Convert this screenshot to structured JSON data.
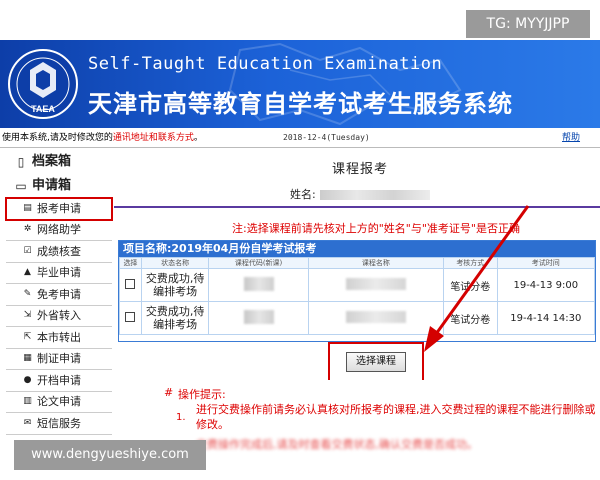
{
  "watermark_top": "TG: MYYJJPP",
  "watermark_bottom": "www.dengyueshiye.com",
  "banner": {
    "title_en": "Self-Taught Education Examination",
    "title_cn": "天津市高等教育自学考试考生服务系统",
    "logo_text": "TAEA",
    "bg_color": "#1c62d8"
  },
  "infobar": {
    "notice_prefix": "使用本系统,请及时修改您的",
    "notice_red": "通讯地址和联系方式",
    "notice_suffix": "。",
    "date": "2018-12-4(Tuesday)",
    "help": "帮助"
  },
  "sidebar": {
    "sections": [
      {
        "label": "档案箱",
        "icon": "archive-icon"
      },
      {
        "label": "申请箱",
        "icon": "folder-icon"
      }
    ],
    "items": [
      {
        "label": "报考申请",
        "icon": "document-icon",
        "active": true
      },
      {
        "label": "网络助学",
        "icon": "network-icon"
      },
      {
        "label": "成绩核查",
        "icon": "check-icon"
      },
      {
        "label": "毕业申请",
        "icon": "graduation-icon"
      },
      {
        "label": "免考申请",
        "icon": "edit-icon"
      },
      {
        "label": "外省转入",
        "icon": "transfer-in-icon"
      },
      {
        "label": "本市转出",
        "icon": "transfer-out-icon"
      },
      {
        "label": "制证申请",
        "icon": "certificate-icon"
      },
      {
        "label": "开档申请",
        "icon": "person-icon"
      },
      {
        "label": "论文申请",
        "icon": "paper-icon"
      },
      {
        "label": "短信服务",
        "icon": "sms-icon"
      }
    ]
  },
  "main": {
    "page_title": "课程报考",
    "name_label": "姓名:",
    "warning": "注:选择课程前请先核对上方的\"姓名\"与\"准考证号\"是否正确",
    "project_title": "项目名称:2019年04月份自学考试报考",
    "columns": [
      "选择",
      "状态名称",
      "课程代码(新课)",
      "课程名称",
      "考核方式",
      "考试时间"
    ],
    "rows": [
      {
        "status": "交费成功,待编排考场",
        "method": "笔试分卷",
        "time": "19-4-13 9:00"
      },
      {
        "status": "交费成功,待编排考场",
        "method": "笔试分卷",
        "time": "19-4-14 14:30"
      }
    ],
    "select_button": "选择课程",
    "tips_heading": "操作提示:",
    "tips_hash": "#",
    "tip1_num": "1.",
    "tip1": "进行交费操作前请务必认真核对所报考的课程,进入交费过程的课程不能进行删除或修改。",
    "tip2": "交费操作完成后,请及时查看交费状态,确认交费是否成功。"
  }
}
